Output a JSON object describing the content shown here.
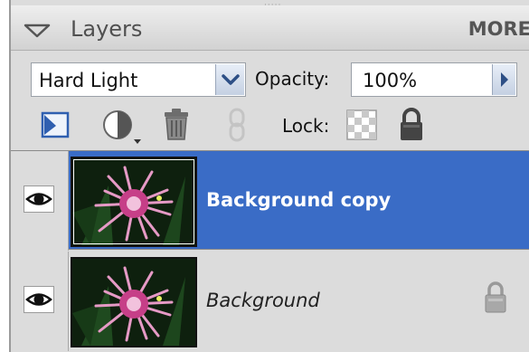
{
  "panel": {
    "title": "Layers",
    "more_label": "MORE",
    "grip": "·····"
  },
  "blend": {
    "mode": "Hard Light",
    "opacity_label": "Opacity:",
    "opacity_value": "100%"
  },
  "toolbar": {
    "lock_label": "Lock:"
  },
  "layers": [
    {
      "name": "Background copy",
      "selected": true,
      "visible": true,
      "locked": false
    },
    {
      "name": "Background",
      "selected": false,
      "visible": true,
      "locked": true
    }
  ],
  "colors": {
    "selection": "#3a6cc6",
    "panel_bg": "#dcdcdc",
    "tool_blue": "#2f5fb0"
  }
}
